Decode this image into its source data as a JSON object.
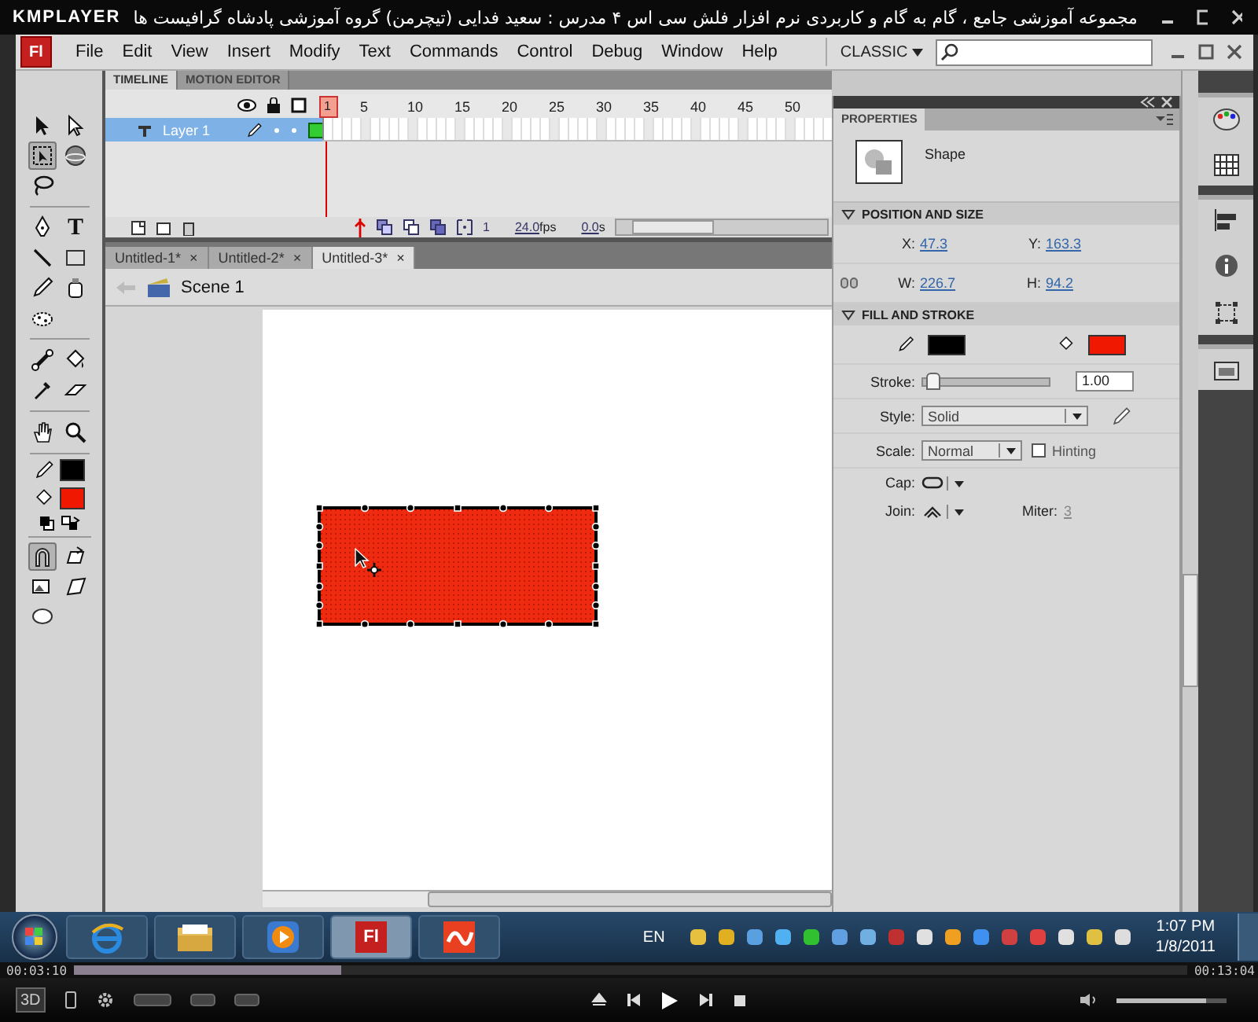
{
  "player": {
    "logo": "KMPLAYER",
    "title": "مجموعه آموزشی جامع ، گام به گام و کاربردی نرم افزار فلش سی اس ۴ مدرس : سعید فدایی (تیچرمن) گروه آموزشی پادشاه گرافیست ها",
    "elapsed": "00:03:10",
    "total": "00:13:04",
    "progress": {
      "level": 0.24
    },
    "mode_button": "3D",
    "volume": {
      "level": 0.82
    }
  },
  "app": {
    "logo": "Fl",
    "menu": [
      "File",
      "Edit",
      "View",
      "Insert",
      "Modify",
      "Text",
      "Commands",
      "Control",
      "Debug",
      "Window",
      "Help"
    ],
    "workspace": "CLASSIC"
  },
  "timeline": {
    "tabs": [
      {
        "label": "TIMELINE",
        "selected": true
      },
      {
        "label": "MOTION EDITOR",
        "selected": false
      }
    ],
    "frame_numbers": [
      "1",
      "5",
      "10",
      "15",
      "20",
      "25",
      "30",
      "35",
      "40",
      "45",
      "50"
    ],
    "layers": [
      {
        "name": "Layer 1",
        "selected": true
      }
    ],
    "current_frame": "1",
    "frame_rate": "24.0",
    "frame_rate_unit": "fps",
    "elapsed": "0.0",
    "elapsed_unit": "s"
  },
  "toolbox": {
    "upper": [
      {
        "kind": "icon",
        "selected": false
      },
      {
        "kind": "icon",
        "selected": false
      },
      {
        "kind": "icon",
        "selected": true
      },
      {
        "kind": "icon",
        "selected": false
      },
      {
        "kind": "icon",
        "selected": false
      },
      {
        "kind": "separator"
      },
      {
        "kind": "icon",
        "selected": false
      },
      {
        "kind": "glyph",
        "text": "T",
        "selected": false
      },
      {
        "kind": "icon",
        "selected": false
      },
      {
        "kind": "icon",
        "selected": false
      },
      {
        "kind": "icon",
        "selected": false
      },
      {
        "kind": "icon",
        "selected": false
      },
      {
        "kind": "icon",
        "selected": false
      },
      {
        "kind": "separator"
      },
      {
        "kind": "icon",
        "selected": false
      },
      {
        "kind": "icon",
        "selected": false
      },
      {
        "kind": "icon",
        "selected": false
      },
      {
        "kind": "icon",
        "selected": false
      },
      {
        "kind": "separator"
      },
      {
        "kind": "icon",
        "selected": false
      },
      {
        "kind": "icon",
        "selected": false
      }
    ],
    "swatches": [
      {
        "kind": "stroke",
        "color": "#000000"
      },
      {
        "kind": "fill",
        "color": "#f01800"
      }
    ],
    "lower": [
      {
        "kind": "icon",
        "selected": true
      },
      {
        "kind": "icon",
        "selected": false
      },
      {
        "kind": "icon",
        "selected": false
      },
      {
        "kind": "icon",
        "selected": false
      },
      {
        "kind": "icon",
        "selected": false
      }
    ]
  },
  "documents": [
    {
      "title": "Untitled-1*",
      "close": "×",
      "selected": false
    },
    {
      "title": "Untitled-2*",
      "close": "×",
      "selected": false
    },
    {
      "title": "Untitled-3*",
      "close": "×",
      "selected": true
    }
  ],
  "scene": "Scene 1",
  "properties": {
    "title": "PROPERTIES",
    "object_type": "Shape",
    "position_and_size": {
      "title": "POSITION AND SIZE",
      "expanded": true,
      "fields": [
        {
          "label": "X:",
          "value": "47.3"
        },
        {
          "label": "Y:",
          "value": "163.3"
        },
        {
          "label": "W:",
          "value": "226.7"
        },
        {
          "label": "H:",
          "value": "94.2"
        }
      ]
    },
    "fill_and_stroke": {
      "title": "FILL AND STROKE",
      "expanded": true,
      "swatches": [
        {
          "kind": "stroke",
          "color": "#000000"
        },
        {
          "kind": "fill",
          "color": "#f01800"
        }
      ],
      "stroke": {
        "label": "Stroke:",
        "level": 0.03,
        "value": "1.00"
      },
      "style": {
        "label": "Style:",
        "value": "Solid"
      },
      "scale": {
        "label": "Scale:",
        "value": "Normal"
      },
      "hinting": {
        "label": "Hinting",
        "checked": false
      },
      "cap": {
        "label": "Cap:"
      },
      "join": {
        "label": "Join:"
      },
      "miter": {
        "label": "Miter:",
        "value": "3"
      }
    }
  },
  "taskbar": {
    "apps": [
      {
        "kind": "browser",
        "selected": false
      },
      {
        "kind": "folder",
        "selected": false
      },
      {
        "kind": "media",
        "selected": false
      },
      {
        "kind": "flash",
        "label": "Fl",
        "selected": true
      },
      {
        "kind": "paint",
        "selected": false
      }
    ],
    "language": "EN",
    "time": "1:07 PM",
    "date": "1/8/2011"
  }
}
